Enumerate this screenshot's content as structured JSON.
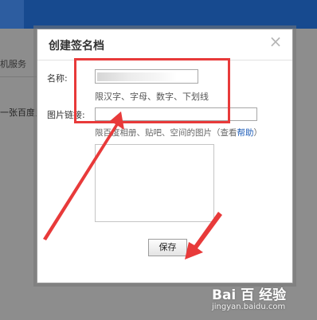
{
  "background": {
    "service_text": "机服务",
    "baidu_text": "一张百度贝"
  },
  "dialog": {
    "title": "创建签名档",
    "close_icon": "close-icon",
    "name_label": "名称:",
    "name_value": "",
    "name_hint": "限汉字、字母、数字、下划线",
    "image_label": "图片链接:",
    "image_value": "",
    "image_hint_prefix": "限百度相册、贴吧、空间的图片（查看",
    "image_hint_link": "帮助",
    "image_hint_suffix": "）",
    "save_label": "保存"
  },
  "annotations": {
    "color": "#e83a3a"
  },
  "watermark": {
    "logo": "Bai 百 经验",
    "url": "jingyan.baidu.com"
  }
}
